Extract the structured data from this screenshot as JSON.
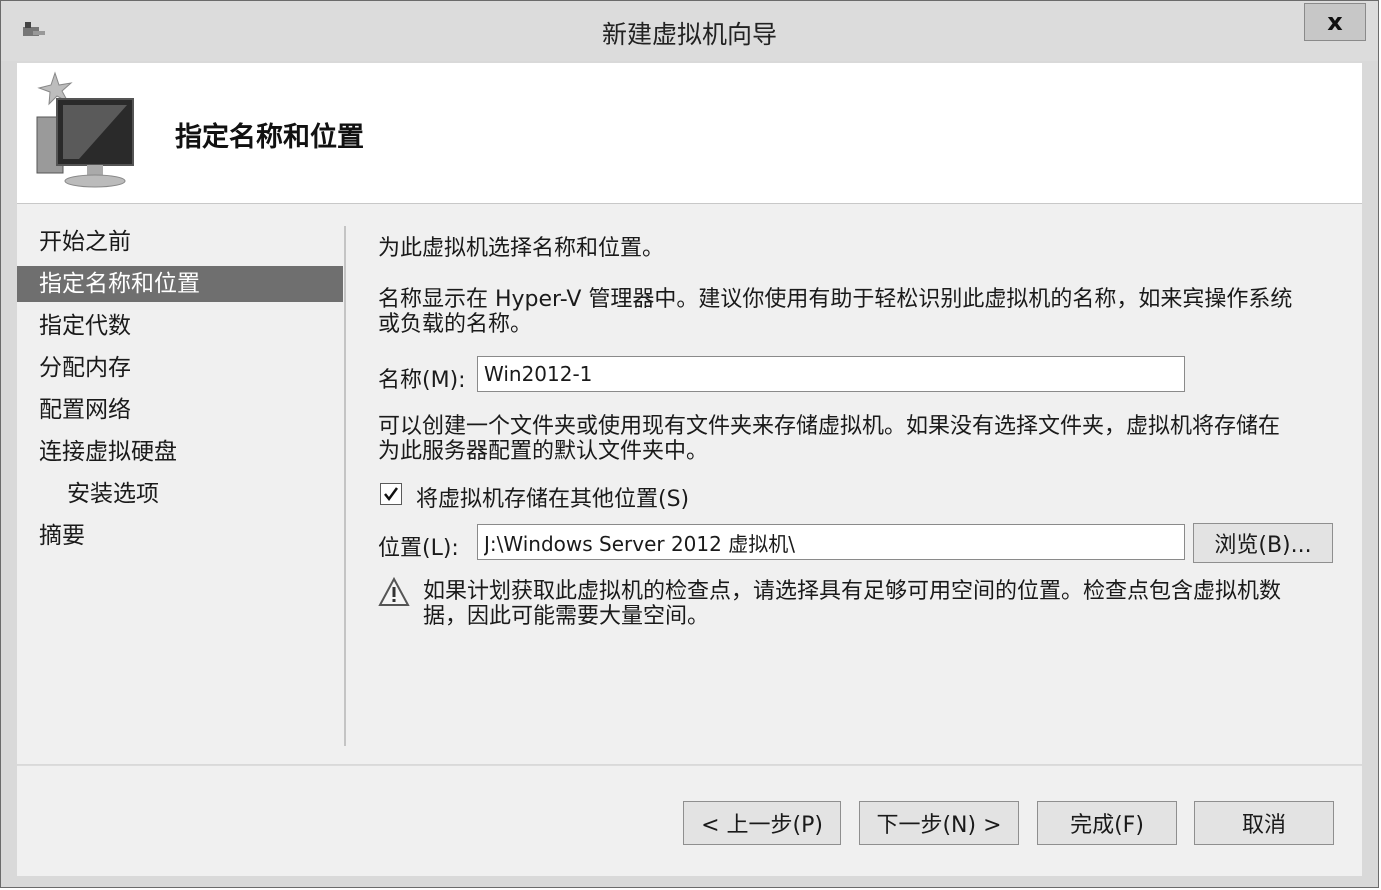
{
  "window": {
    "title": "新建虚拟机向导",
    "close_label": "x"
  },
  "header": {
    "title": "指定名称和位置"
  },
  "nav": {
    "items": [
      {
        "label": "开始之前",
        "selected": false,
        "sub": false
      },
      {
        "label": "指定名称和位置",
        "selected": true,
        "sub": false
      },
      {
        "label": "指定代数",
        "selected": false,
        "sub": false
      },
      {
        "label": "分配内存",
        "selected": false,
        "sub": false
      },
      {
        "label": "配置网络",
        "selected": false,
        "sub": false
      },
      {
        "label": "连接虚拟硬盘",
        "selected": false,
        "sub": false
      },
      {
        "label": "安装选项",
        "selected": false,
        "sub": true
      },
      {
        "label": "摘要",
        "selected": false,
        "sub": false
      }
    ]
  },
  "content": {
    "intro": "为此虚拟机选择名称和位置。",
    "name_desc_1": "名称显示在 Hyper-V 管理器中。建议你使用有助于轻松识别此虚拟机的名称，如来宾操作系统",
    "name_desc_2": "或负载的名称。",
    "name_label": "名称(M):",
    "name_value": "Win2012-1",
    "folder_desc_1": "可以创建一个文件夹或使用现有文件夹来存储虚拟机。如果没有选择文件夹，虚拟机将存储在",
    "folder_desc_2": "为此服务器配置的默认文件夹中。",
    "store_checkbox_label": "将虚拟机存储在其他位置(S)",
    "store_checked": true,
    "location_label": "位置(L):",
    "location_value": "J:\\Windows Server 2012 虚拟机\\",
    "browse_label": "浏览(B)...",
    "warning_1": "如果计划获取此虚拟机的检查点，请选择具有足够可用空间的位置。检查点包含虚拟机数",
    "warning_2": "据，因此可能需要大量空间。"
  },
  "footer": {
    "prev_label": "< 上一步(P)",
    "next_label": "下一步(N) >",
    "finish_label": "完成(F)",
    "cancel_label": "取消"
  },
  "icons": {
    "app": "hyperv-window-icon",
    "header": "new-vm-monitor-icon",
    "checkbox": "check-icon",
    "warning": "warning-icon"
  }
}
